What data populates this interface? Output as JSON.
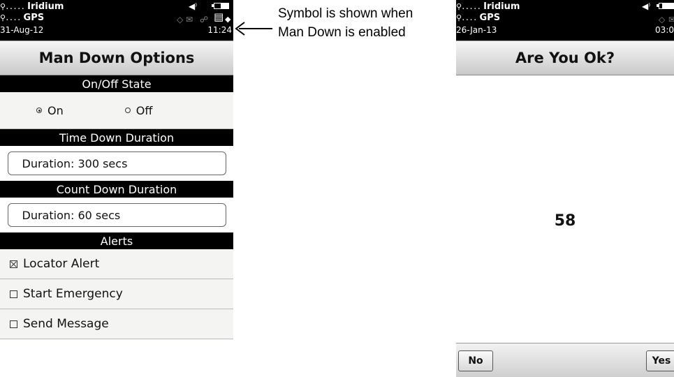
{
  "left_screen": {
    "status": {
      "signal_glyph": "⚲",
      "signal_dots": ".....",
      "network1": "Iridium",
      "network2": "GPS",
      "date": "31-Aug-12",
      "time": "11:24",
      "sound_icon": "speaker-icon",
      "man_down_icon": "man-down-icon"
    },
    "title": "Man Down Options",
    "onoff_header": "On/Off State",
    "on_label": "On",
    "off_label": "Off",
    "selected": "On",
    "time_down_header": "Time Down Duration",
    "time_down_value": "Duration: 300 secs",
    "count_down_header": "Count Down Duration",
    "count_down_value": "Duration: 60 secs",
    "alerts_header": "Alerts",
    "alerts": [
      {
        "label": "Locator Alert",
        "checked": true
      },
      {
        "label": "Start Emergency",
        "checked": false
      },
      {
        "label": "Send Message",
        "checked": false
      }
    ]
  },
  "annotation": {
    "text": "Symbol is shown when Man Down is enabled"
  },
  "right_screen": {
    "status": {
      "network1": "Iridium",
      "network2": "GPS",
      "date": "26-Jan-13",
      "time": "03:0"
    },
    "title": "Are You Ok?",
    "countdown": "58",
    "no_label": "No",
    "yes_label": "Yes"
  },
  "colors": {
    "bar": "#000000",
    "title_gradient_top": "#f6f6f6",
    "title_gradient_bottom": "#c9c9c9",
    "panel_bg": "#f4f5f2"
  }
}
